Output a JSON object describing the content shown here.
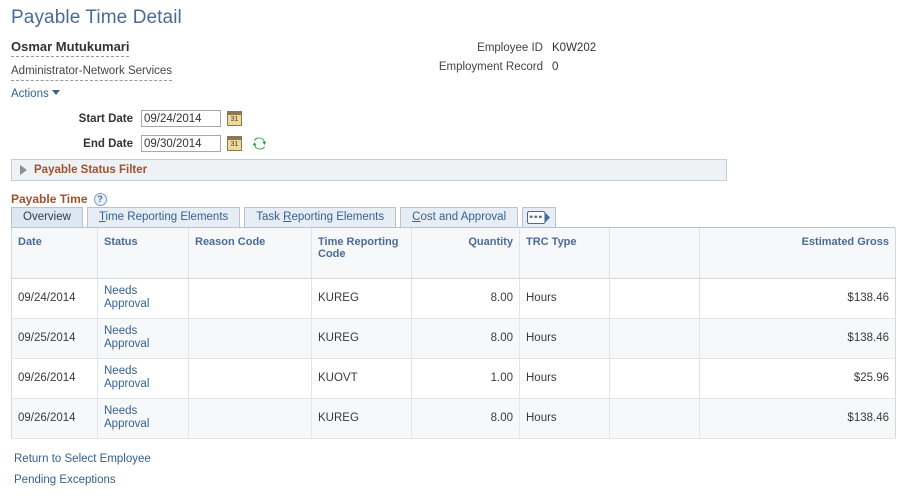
{
  "page": {
    "title": "Payable Time Detail"
  },
  "employee": {
    "name": "Osmar Mutukumari",
    "job_title": "Administrator-Network Services",
    "actions_label": "Actions",
    "id_label": "Employee ID",
    "id_value": "K0W202",
    "record_label": "Employment Record",
    "record_value": "0"
  },
  "date_filter": {
    "start_label": "Start Date",
    "start_value": "09/24/2014",
    "end_label": "End Date",
    "end_value": "09/30/2014",
    "calendar_icon": "calendar-icon",
    "refresh_icon": "refresh-icon"
  },
  "status_filter": {
    "label": "Payable Status Filter",
    "expanded": false,
    "collapse_icon": "triangle-right-icon"
  },
  "payable_time": {
    "title": "Payable Time",
    "help_icon": "help-icon",
    "help_glyph": "?",
    "grid_icon": "show-all-columns-icon",
    "tabs": [
      {
        "label": "Overview",
        "accesskey": "",
        "active": true
      },
      {
        "label": "Time Reporting Elements",
        "accesskey": "T",
        "active": false
      },
      {
        "label": "Task Reporting Elements",
        "accesskey": "R",
        "active": false
      },
      {
        "label": "Cost and Approval",
        "accesskey": "C",
        "active": false
      }
    ],
    "columns": [
      {
        "label": "Date",
        "align": "left"
      },
      {
        "label": "Status",
        "align": "left"
      },
      {
        "label": "Reason Code",
        "align": "left"
      },
      {
        "label": "Time Reporting Code",
        "align": "left"
      },
      {
        "label": "Quantity",
        "align": "right"
      },
      {
        "label": "TRC Type",
        "align": "left"
      },
      {
        "label": "",
        "align": "left"
      },
      {
        "label": "Estimated Gross",
        "align": "right"
      }
    ],
    "rows": [
      {
        "date": "09/24/2014",
        "status": "Needs Approval",
        "reason_code": "",
        "trc": "KUREG",
        "quantity": "8.00",
        "trc_type": "Hours",
        "blank": "",
        "estimated_gross": "$138.46"
      },
      {
        "date": "09/25/2014",
        "status": "Needs Approval",
        "reason_code": "",
        "trc": "KUREG",
        "quantity": "8.00",
        "trc_type": "Hours",
        "blank": "",
        "estimated_gross": "$138.46"
      },
      {
        "date": "09/26/2014",
        "status": "Needs Approval",
        "reason_code": "",
        "trc": "KUOVT",
        "quantity": "1.00",
        "trc_type": "Hours",
        "blank": "",
        "estimated_gross": "$25.96"
      },
      {
        "date": "09/26/2014",
        "status": "Needs Approval",
        "reason_code": "",
        "trc": "KUREG",
        "quantity": "8.00",
        "trc_type": "Hours",
        "blank": "",
        "estimated_gross": "$138.46"
      }
    ]
  },
  "footer": {
    "links": [
      {
        "label": "Return to Select Employee"
      },
      {
        "label": "Pending Exceptions"
      }
    ]
  },
  "colors": {
    "page_title": "#4a6b96",
    "section_heading": "#a0522d",
    "link": "#37618f",
    "column_header": "#4a6b96",
    "filter_bar_bg": "#eff2f4"
  }
}
